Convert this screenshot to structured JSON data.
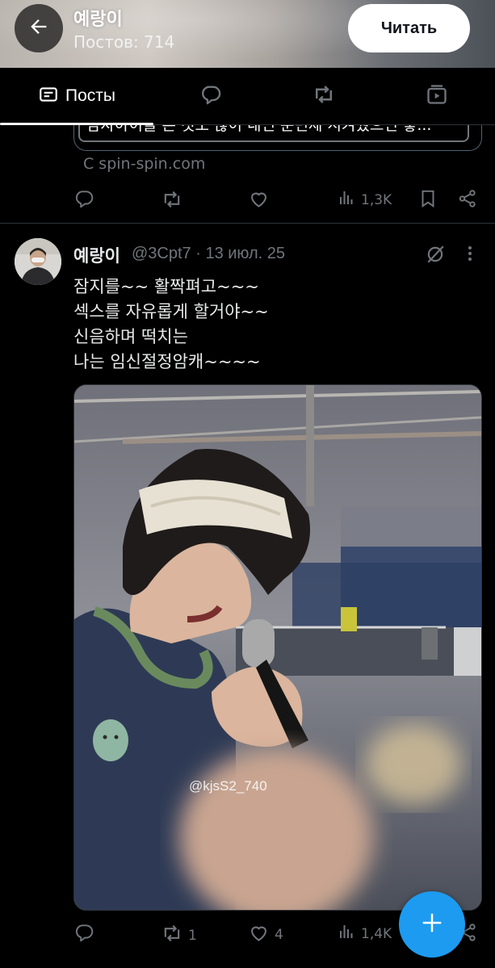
{
  "header": {
    "name": "예랑이",
    "post_count": "Постов: 714",
    "follow_label": "Читать"
  },
  "tabs": {
    "posts_label": "Посты"
  },
  "previous_post": {
    "card_title": "남자아이들 본 것도 많이 내면 준번제 시켜줬으면 좋...",
    "card_source": "С spin-spin.com",
    "views": "1,3K"
  },
  "post": {
    "name": "예랑이",
    "handle_date": "@3Cpt7 · 13 июл. 25",
    "lines": [
      "잠지를~~ 활짝펴고~~~",
      "섹스를 자유롭게 할거야~~",
      "신음하며 떡치는",
      "나는 임신절정암캐~~~~"
    ],
    "watermark": "@kjsS2_740",
    "reposts": "1",
    "likes": "4",
    "views": "1,4K"
  },
  "colors": {
    "accent": "#1d9bf0",
    "muted": "#71767b",
    "text": "#e7e9ea",
    "background": "#000000"
  },
  "icons": {
    "back": "arrow-left-icon",
    "tab_posts": "posts-icon",
    "tab_replies": "reply-icon",
    "tab_reposts": "repost-icon",
    "tab_media": "media-icon",
    "reply": "reply-icon",
    "repost": "repost-icon",
    "like": "heart-icon",
    "views": "views-icon",
    "bookmark": "bookmark-icon",
    "share": "share-icon",
    "grok": "grok-icon",
    "more": "more-icon",
    "compose": "plus-icon"
  }
}
